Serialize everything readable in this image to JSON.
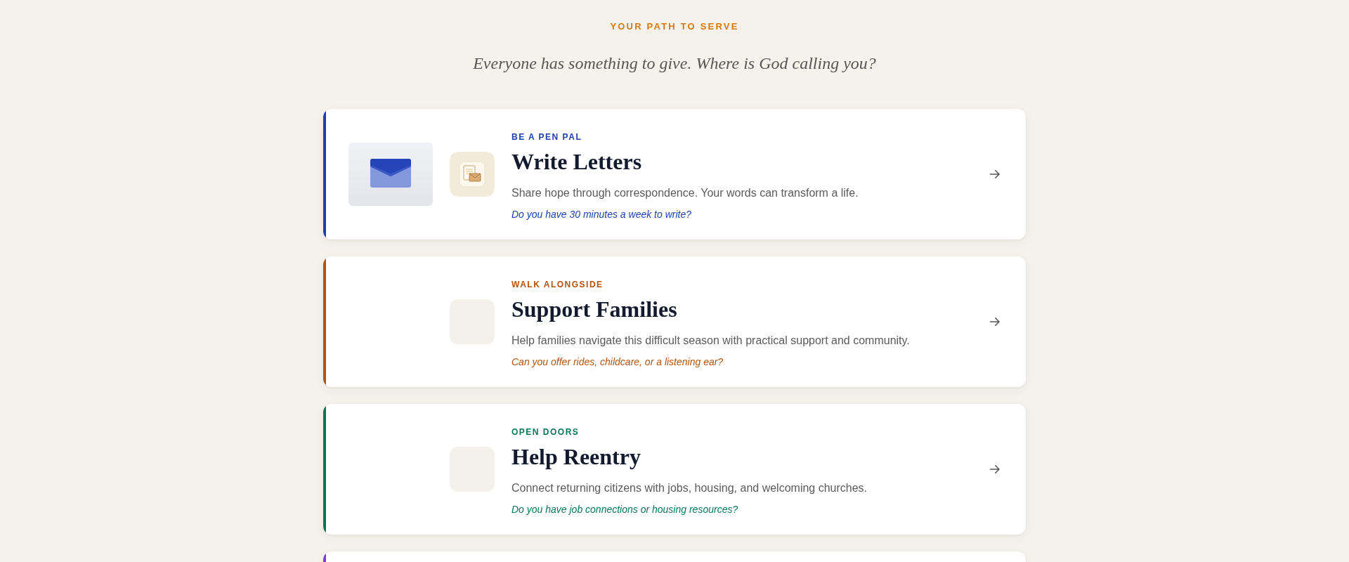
{
  "header": {
    "eyebrow": "YOUR PATH TO SERVE",
    "subtitle": "Everyone has something to give. Where is God calling you?"
  },
  "cards": [
    {
      "kind": "illustrated",
      "color": "#1e40af",
      "label": "BE A PEN PAL",
      "title": "Write Letters",
      "description": "Share hope through correspondence. Your words can transform a life.",
      "question": "Do you have 30 minutes a week to write?"
    },
    {
      "kind": "plain",
      "color": "#b45309",
      "label": "WALK ALONGSIDE",
      "title": "Support Families",
      "description": "Help families navigate this difficult season with practical support and community.",
      "question": "Can you offer rides, childcare, or a listening ear?"
    },
    {
      "kind": "plain",
      "color": "#047857",
      "label": "OPEN DOORS",
      "title": "Help Reentry",
      "description": "Connect returning citizens with jobs, housing, and welcoming churches.",
      "question": "Do you have job connections or housing resources?"
    },
    {
      "color": "#7c3aed"
    }
  ]
}
